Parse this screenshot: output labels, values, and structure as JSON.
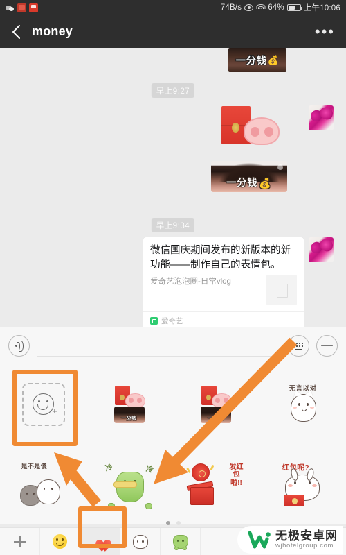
{
  "status_bar": {
    "left_icons": [
      "wechat-icon",
      "app-icon-red",
      "app-icon-red-2"
    ],
    "net_speed": "74B/s",
    "eye_icon": "eye-icon",
    "wifi_icon": "wifi-icon",
    "battery_percent": "64%",
    "battery_icon": "battery-icon",
    "clock": "上午10:06"
  },
  "nav": {
    "back_icon": "chevron-left-icon",
    "title": "money",
    "more_icon": "more-horizontal-icon"
  },
  "chat": {
    "messages": [
      {
        "type": "sticker",
        "name": "sticker-yifenqian-dark",
        "text": "一分钱",
        "emoji": "💰"
      },
      {
        "type": "timestamp",
        "text": "早上9:27"
      },
      {
        "type": "sticker",
        "name": "sticker-redpacket-pignose",
        "text": ""
      },
      {
        "type": "sticker",
        "name": "sticker-yifenqian-forehead",
        "text": "一分钱",
        "emoji": "💰"
      },
      {
        "type": "timestamp",
        "text": "早上9:34"
      },
      {
        "type": "link-card",
        "title": "微信国庆期间发布的新版本的新功能——制作自己的表情包。",
        "subtitle": "爱奇艺泡泡圈-日常vlog",
        "source": "爱奇艺",
        "source_icon": "iqiyi-icon"
      }
    ]
  },
  "input_bar": {
    "voice_icon": "voice-icon",
    "text_value": "",
    "text_placeholder": "",
    "keyboard_icon": "keyboard-icon",
    "plus_icon": "plus-icon"
  },
  "sticker_panel": {
    "items": [
      {
        "name": "add-sticker-button",
        "label": "",
        "icon": "smiley-plus-icon"
      },
      {
        "name": "sticker-redpacket-pig-head",
        "label": "一分钱"
      },
      {
        "name": "sticker-redpacket-pig-head-2",
        "label": "一分钱"
      },
      {
        "name": "sticker-cat-speechless",
        "label": "无言以对"
      },
      {
        "name": "sticker-two-cats",
        "label": "是不是傻"
      },
      {
        "name": "sticker-frog-cold",
        "label": "冷 冷"
      },
      {
        "name": "sticker-send-redpacket",
        "label": "发红包啦!!"
      },
      {
        "name": "sticker-rabbit-redpacket",
        "label": "红包呢?"
      }
    ]
  },
  "pagination": {
    "total": 2,
    "active_index": 0
  },
  "toolbar": {
    "tabs": [
      {
        "name": "tab-add",
        "icon": "plus-icon",
        "selected": false
      },
      {
        "name": "tab-emoji",
        "icon": "smiley-icon",
        "selected": false
      },
      {
        "name": "tab-favorites",
        "icon": "heart-icon",
        "selected": true
      },
      {
        "name": "tab-cat-pack",
        "icon": "cat-icon",
        "selected": false
      },
      {
        "name": "tab-frog-pack",
        "icon": "frog-icon",
        "selected": false
      }
    ]
  },
  "annotations": {
    "color": "#f08a33",
    "highlight_add_sticker": "box-around-add-sticker-button",
    "highlight_favorites_tab": "box-around-favorites-tab",
    "arrow_to_keyboard": "arrow-pointing-to-sticker-grid",
    "arrow_to_add_sticker": "arrow-pointing-to-add-sticker-button"
  },
  "watermark": {
    "cn": "无极安卓网",
    "en": "wjhotelgroup.com",
    "logo": "w-logo-icon"
  }
}
